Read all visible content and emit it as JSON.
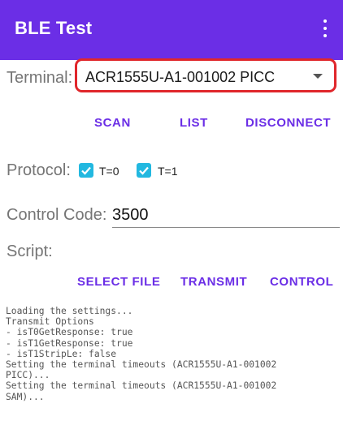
{
  "app_bar": {
    "title": "BLE Test",
    "background": "#6b2ee6",
    "menu_icon": "more-vert-icon"
  },
  "terminal": {
    "label": "Terminal:",
    "selected": "ACR1555U-A1-001002 PICC",
    "highlight_color": "#e0262b"
  },
  "connection_buttons": {
    "scan": "SCAN",
    "list": "LIST",
    "disconnect": "DISCONNECT"
  },
  "protocol": {
    "label": "Protocol:",
    "options": [
      {
        "label": "T=0",
        "checked": true
      },
      {
        "label": "T=1",
        "checked": true
      }
    ],
    "checkbox_color": "#22b8e0"
  },
  "control_code": {
    "label": "Control Code:",
    "value": "3500"
  },
  "script": {
    "label": "Script:"
  },
  "action_buttons": {
    "select_file": "SELECT FILE",
    "transmit": "TRANSMIT",
    "control": "CONTROL"
  },
  "log": {
    "text": "Loading the settings...\nTransmit Options\n- isT0GetResponse: true\n- isT1GetResponse: true\n- isT1StripLe: false\nSetting the terminal timeouts (ACR1555U-A1-001002\nPICC)...\nSetting the terminal timeouts (ACR1555U-A1-001002\nSAM)..."
  }
}
